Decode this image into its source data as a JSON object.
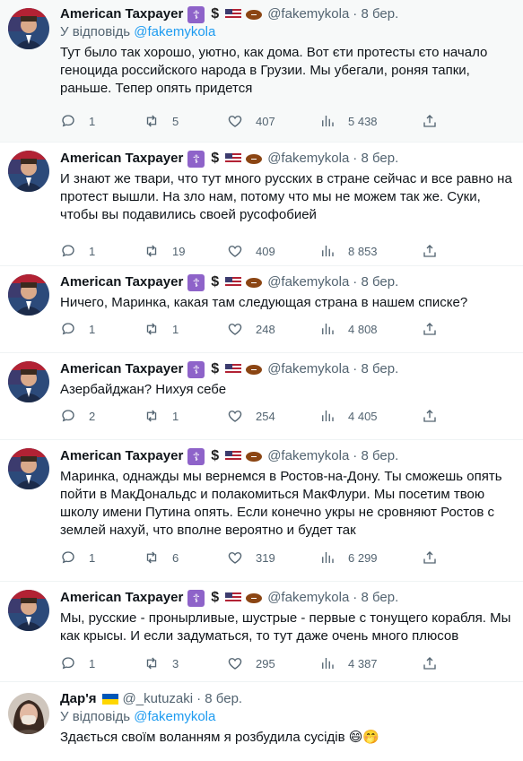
{
  "reply_prefix": "У відповідь",
  "tweets": [
    {
      "name": "American Taxpayer",
      "handle": "@fakemykola",
      "date": "· 8 бер.",
      "reply_to": "@fakemykola",
      "text": "Тут было так хорошо, уютно, как дома. Вот єти протесты єто начало геноцида российского народа в Грузии. Мы убегали, роняя тапки, раньше. Тепер опять придется",
      "replies": "1",
      "retweets": "5",
      "likes": "407",
      "views": "5 438"
    },
    {
      "name": "American Taxpayer",
      "handle": "@fakemykola",
      "date": "· 8 бер.",
      "reply_to": "",
      "text": "И знают же твари, что тут много русских в стране сейчас и все равно на протест вышли. На зло нам, потому что мы не можем так же. Суки, чтобы вы подавились своей русофобией",
      "replies": "1",
      "retweets": "19",
      "likes": "409",
      "views": "8 853"
    },
    {
      "name": "American Taxpayer",
      "handle": "@fakemykola",
      "date": "· 8 бер.",
      "reply_to": "",
      "text": "Ничего, Маринка, какая там следующая страна в нашем списке?",
      "replies": "1",
      "retweets": "1",
      "likes": "248",
      "views": "4 808"
    },
    {
      "name": "American Taxpayer",
      "handle": "@fakemykola",
      "date": "· 8 бер.",
      "reply_to": "",
      "text": "Азербайджан? Нихуя себе",
      "replies": "2",
      "retweets": "1",
      "likes": "254",
      "views": "4 405"
    },
    {
      "name": "American Taxpayer",
      "handle": "@fakemykola",
      "date": "· 8 бер.",
      "reply_to": "",
      "text": "Маринка, однажды мы вернемся в Ростов-на-Дону. Ты сможешь опять пойти в МакДональдс и полакомиться МакФлури. Мы посетим твою школу имени Путина опять. Если конечно укры не сровняют Ростов с землей нахуй, что вполне вероятно и будет так",
      "replies": "1",
      "retweets": "6",
      "likes": "319",
      "views": "6 299"
    },
    {
      "name": "American Taxpayer",
      "handle": "@fakemykola",
      "date": "· 8 бер.",
      "reply_to": "",
      "text": "Мы, русские - пронырливые, шустрые - первые с тонущего корабля. Мы как крысы. И если задуматься, то тут даже очень много плюсов",
      "replies": "1",
      "retweets": "3",
      "likes": "295",
      "views": "4 387"
    },
    {
      "name": "Дар'я",
      "handle": "@_kutuzaki",
      "date": "· 8 бер.",
      "reply_to": "@fakemykola",
      "text": "Здається своїм воланням я розбудила сусідів 😄🤭"
    }
  ],
  "icons": {
    "reply": "speech-bubble-icon",
    "retweet": "retweet-icon",
    "like": "heart-icon",
    "views": "bar-chart-icon",
    "share": "share-icon"
  },
  "colors": {
    "link": "#1d9bf0",
    "muted": "#536471",
    "verified_cross": "#8e63c9",
    "highlight_bg": "#f7f9f9"
  }
}
